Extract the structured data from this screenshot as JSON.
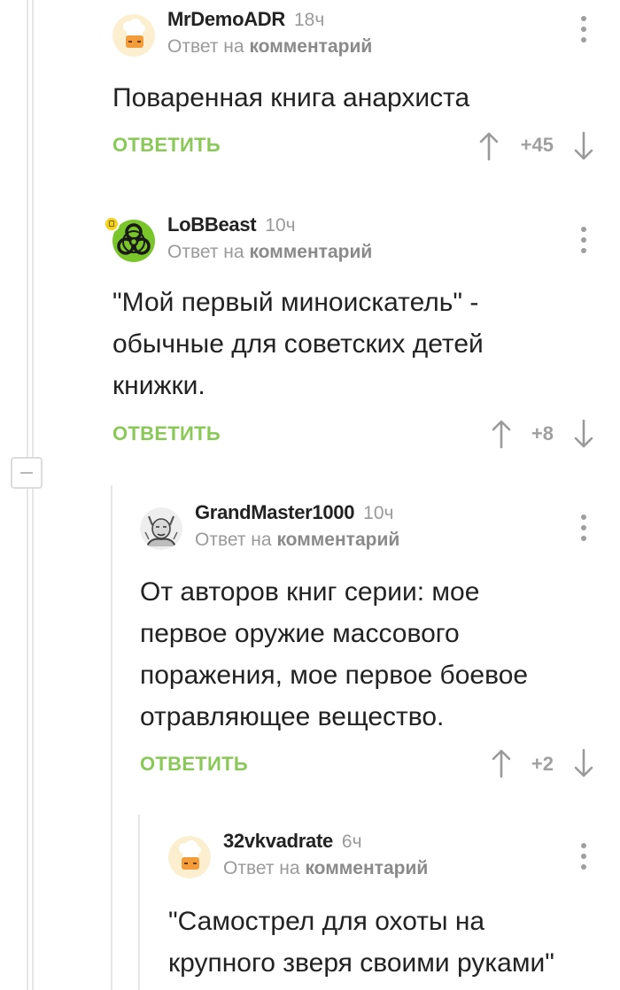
{
  "comments": [
    {
      "author": "MrDemoADR",
      "time": "18ч",
      "reply_prefix": "Ответ на",
      "reply_target": "комментарий",
      "lines": [
        "Поваренная книга анархиста"
      ],
      "reply_label": "ОТВЕТИТЬ",
      "score": "+45",
      "avatar": "chef-icon"
    },
    {
      "author": "LoBBeast",
      "time": "10ч",
      "reply_prefix": "Ответ на",
      "reply_target": "комментарий",
      "lines": [
        "\"Мой первый миноискатель\" -",
        "обычные для советских детей",
        "книжки."
      ],
      "reply_label": "ОТВЕТИТЬ",
      "score": "+8",
      "avatar": "biohazard-icon"
    },
    {
      "author": "GrandMaster1000",
      "time": "10ч",
      "reply_prefix": "Ответ на",
      "reply_target": "комментарий",
      "lines": [
        "От авторов книг серии: мое",
        "первое оружие массового",
        "поражения, мое первое боевое",
        "отравляющее вещество."
      ],
      "reply_label": "ОТВЕТИТЬ",
      "score": "+2",
      "avatar": "sketch-portrait-icon"
    },
    {
      "author": "32vkvadrate",
      "time": "6ч",
      "reply_prefix": "Ответ на",
      "reply_target": "комментарий",
      "lines": [
        "\"Самострел для охоты на",
        "крупного зверя своими руками\""
      ],
      "avatar": "chef-icon"
    }
  ],
  "colors": {
    "accent": "#8ac858",
    "muted": "#9a9a9a",
    "thread_line": "#e6e6e6"
  }
}
